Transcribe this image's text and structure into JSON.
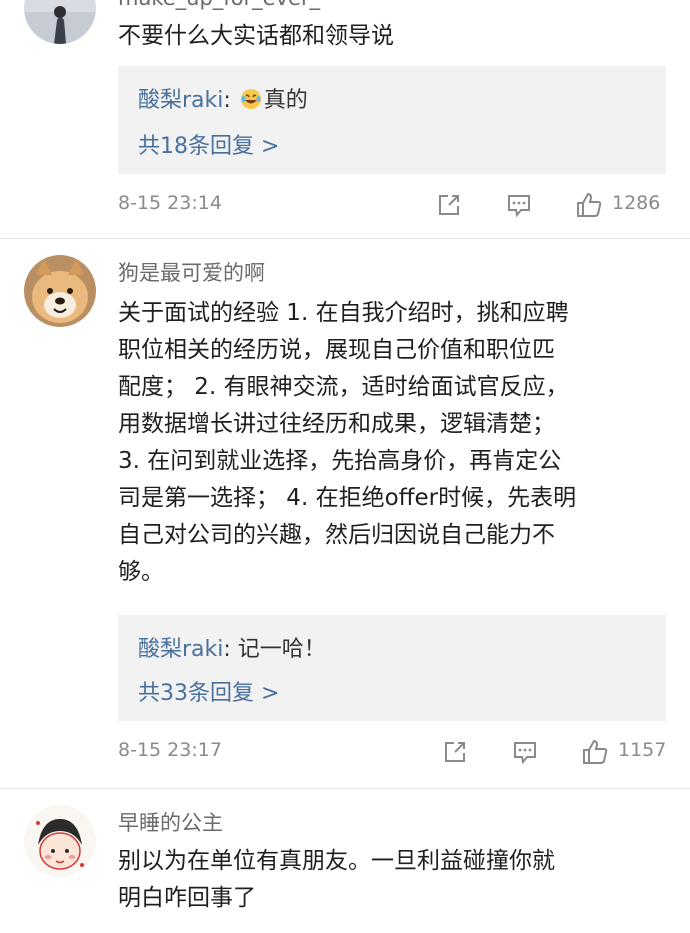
{
  "comments": [
    {
      "username": "make_up_for_ever_",
      "text": "不要什么大实话都和领导说",
      "reply": {
        "author": "酸梨raki",
        "sep": ": ",
        "text": "真的",
        "emoji": "laughing-tears-emoji"
      },
      "reply_count": "共18条回复 >",
      "time": "8-15 23:14",
      "likes": "1286"
    },
    {
      "username": "狗是最可爱的啊",
      "lines": [
        "关于面试的经验 1. 在自我介绍时，挑和应聘",
        "职位相关的经历说，展现自己价值和职位匹",
        "配度；  2. 有眼神交流，适时给面试官反应，",
        "用数据增长讲过往经历和成果，逻辑清楚；",
        "3. 在问到就业选择，先抬高身价，再肯定公",
        "司是第一选择；  4. 在拒绝offer时候，先表明",
        "自己对公司的兴趣，然后归因说自己能力不",
        "够。"
      ],
      "reply": {
        "author": "酸梨raki",
        "sep": ": ",
        "text": "记一哈！"
      },
      "reply_count": "共33条回复 >",
      "time": "8-15 23:17",
      "likes": "1157"
    },
    {
      "username": "早睡的公主",
      "lines": [
        "别以为在单位有真朋友。一旦利益碰撞你就",
        "明白咋回事了"
      ]
    }
  ],
  "colors": {
    "link": "#49709c",
    "reply_bg": "#f2f2f2",
    "meta": "#8a8a8a"
  }
}
